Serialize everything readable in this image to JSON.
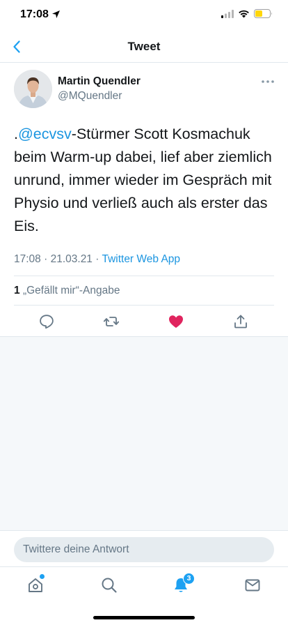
{
  "status_bar": {
    "time": "17:08",
    "icons": [
      "location-arrow-icon",
      "cellular-signal-icon",
      "wifi-icon",
      "battery-icon"
    ],
    "battery_color": "#ffd60a"
  },
  "nav": {
    "title": "Tweet",
    "back_icon": "chevron-left-icon"
  },
  "tweet": {
    "author_name": "Martin Quendler",
    "author_handle": "@MQuendler",
    "text_prefix": ".",
    "mention": "@ecvsv",
    "text_body": "-Stürmer  Scott Kosmachuk beim Warm-up dabei, lief aber ziemlich unrund, immer wieder im Gespräch mit Physio und verließ auch als erster das Eis.",
    "time": "17:08",
    "date": "21.03.21",
    "separator": "·",
    "source": "Twitter Web App",
    "like_count": "1",
    "like_label": "„Gefällt mir“-Angabe",
    "liked": true
  },
  "actions": [
    "reply-icon",
    "retweet-icon",
    "like-icon",
    "share-icon"
  ],
  "reply": {
    "placeholder": "Twittere deine Antwort"
  },
  "tab_bar": {
    "tabs": [
      "home-icon",
      "search-icon",
      "notifications-icon",
      "messages-icon"
    ],
    "notifications_badge": "3"
  },
  "colors": {
    "accent": "#1da1f2",
    "link": "#1b95e0",
    "like": "#e0245e",
    "secondary_text": "#657786",
    "background_gray": "#f5f8fa"
  }
}
